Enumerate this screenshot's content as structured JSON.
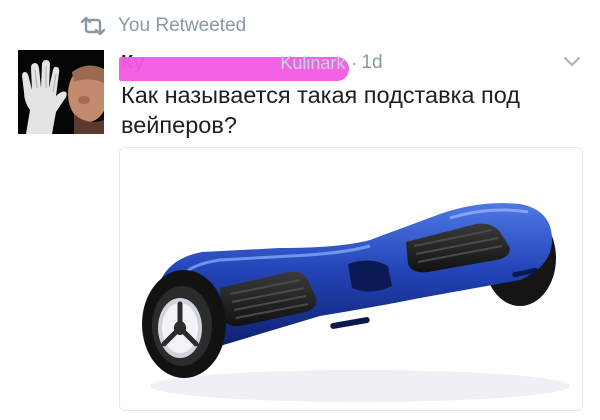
{
  "retweet": {
    "label": "You Retweeted",
    "icon": "retweet-icon",
    "color": "#8899a6"
  },
  "tweet": {
    "author_name": "Ку",
    "author_handle": "Kulinark",
    "separator": "·",
    "time": "1d",
    "text": "Как называется такая подставка под вейперов?"
  },
  "colors": {
    "redaction": "#f25ce3",
    "hoverboard": "#1e3ea8",
    "meta": "#8899a6"
  }
}
